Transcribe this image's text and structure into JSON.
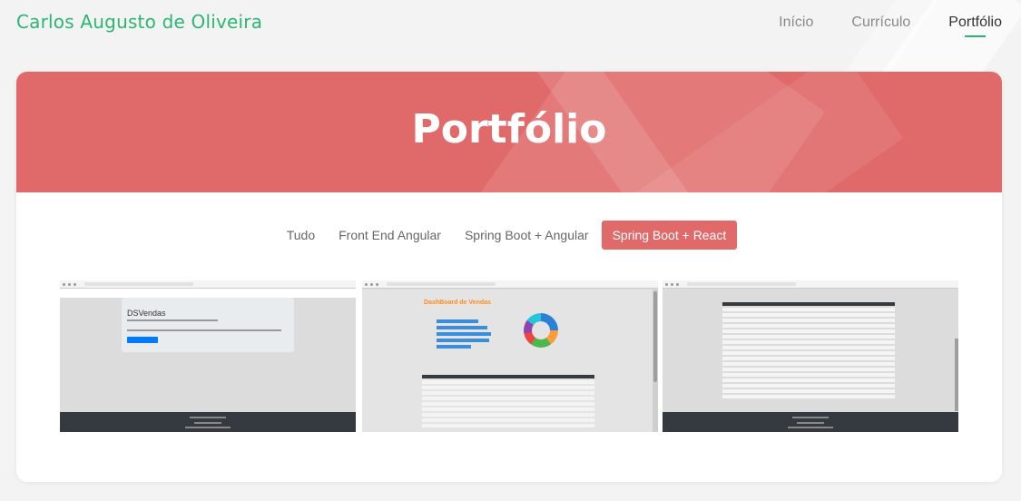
{
  "site": {
    "brand": "Carlos Augusto de Oliveira"
  },
  "nav": {
    "items": [
      {
        "label": "Início"
      },
      {
        "label": "Currículo"
      },
      {
        "label": "Portfólio"
      }
    ]
  },
  "hero": {
    "title": "Portfólio"
  },
  "filters": [
    {
      "label": "Tudo"
    },
    {
      "label": "Front End Angular"
    },
    {
      "label": "Spring Boot + Angular"
    },
    {
      "label": "Spring Boot + React"
    }
  ],
  "thumbs": {
    "dsvendas_home": {
      "title": "DSVendas"
    },
    "dsvendas_dashboard": {
      "title": "DashBoard de Vendas"
    }
  },
  "colors": {
    "brand": "#2bb673",
    "hero": "#e06a6a",
    "active_filter": "#e06a6a"
  }
}
